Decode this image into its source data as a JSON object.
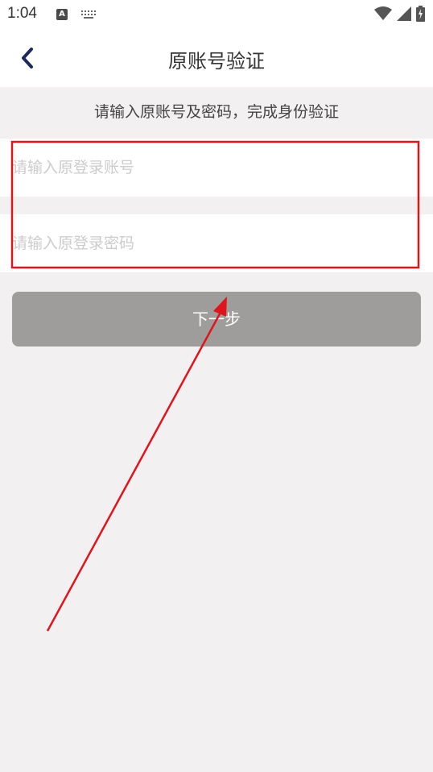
{
  "status_bar": {
    "time": "1:04",
    "icons": [
      "text-a-icon",
      "keyboard-icon",
      "wifi-icon",
      "signal-icon",
      "battery-charging-icon"
    ]
  },
  "header": {
    "title": "原账号验证",
    "back_icon": "chevron-left-icon"
  },
  "hint": "请输入原账号及密码，完成身份验证",
  "form": {
    "account_placeholder": "请输入原登录账号",
    "account_value": "",
    "password_placeholder": "请输入原登录密码",
    "password_value": ""
  },
  "next_button": "下一步",
  "colors": {
    "accent_back": "#1c2a5c",
    "button_bg": "#9e9d9c",
    "annotation_red": "#e0151b",
    "page_bg": "#f2f0f0"
  }
}
